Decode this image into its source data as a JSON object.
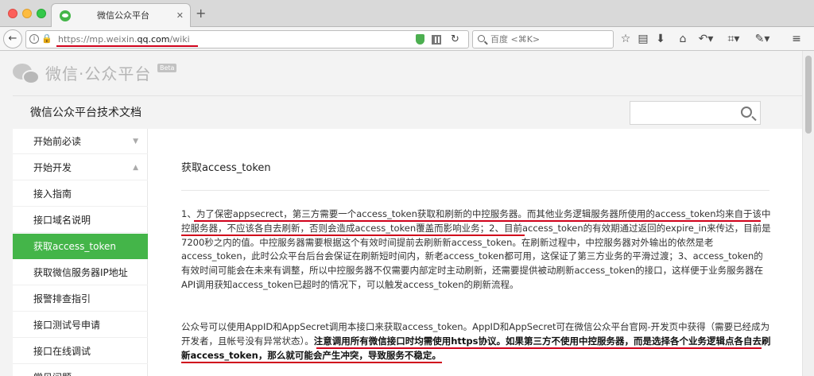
{
  "browser": {
    "tab_title": "微信公众平台",
    "tab_close": "✕",
    "new_tab": "+",
    "url_prefix": "https://mp.weixin.",
    "url_domain": "qq.com",
    "url_suffix": "/wiki",
    "search_placeholder": "百度 <⌘K>",
    "icons": [
      "star-icon",
      "reader-icon",
      "download-icon",
      "home-icon",
      "undo-icon",
      "crop-icon",
      "extension-icon",
      "menu-icon"
    ]
  },
  "site": {
    "logo_text": "微信·公众平台",
    "beta": "Beta"
  },
  "docs": {
    "title": "微信公众平台技术文档"
  },
  "sidebar": {
    "items": [
      {
        "label": "开始前必读",
        "chevron": "▼"
      },
      {
        "label": "开始开发",
        "chevron": "▲"
      },
      {
        "label": "接入指南",
        "chevron": ""
      },
      {
        "label": "接口域名说明",
        "chevron": ""
      },
      {
        "label": "获取access_token",
        "chevron": ""
      },
      {
        "label": "获取微信服务器IP地址",
        "chevron": ""
      },
      {
        "label": "报警排查指引",
        "chevron": ""
      },
      {
        "label": "接口测试号申请",
        "chevron": ""
      },
      {
        "label": "接口在线调试",
        "chevron": ""
      },
      {
        "label": "常见问题",
        "chevron": ""
      }
    ]
  },
  "content": {
    "title": "获取access_token",
    "paragraph1": "1、为了保密appsecrect，第三方需要一个access_token获取和刷新的中控服务器。而其他业务逻辑服务器所使用的access_token均来自于该中控服务器，不应该各自去刷新，否则会造成access_token覆盖而影响业务；2、目前access_token的有效期通过返回的expire_in来传达，目前是7200秒之内的值。中控服务器需要根据这个有效时间提前去刷新新access_token。在刷新过程中，中控服务器对外输出的依然是老access_token，此时公众平台后台会保证在刷新短时间内，新老access_token都可用，这保证了第三方业务的平滑过渡；3、access_token的有效时间可能会在未来有调整，所以中控服务器不仅需要内部定时主动刷新，还需要提供被动刷新access_token的接口，这样便于业务服务器在API调用获知access_token已超时的情况下，可以触发access_token的刷新流程。",
    "paragraph2_plain": "公众号可以使用AppID和AppSecret调用本接口来获取access_token。AppID和AppSecret可在微信公众平台官网-开发页中获得（需要已经成为开发者，且帐号没有异常状态）。",
    "paragraph2_bold": "注意调用所有微信接口时均需使用https协议。如果第三方不使用中控服务器，而是选择各个业务逻辑点各自去刷新access_token，那么就可能会产生冲突，导致服务不稳定。"
  },
  "colors": {
    "accent": "#44b549",
    "annotation": "#d0021b"
  }
}
